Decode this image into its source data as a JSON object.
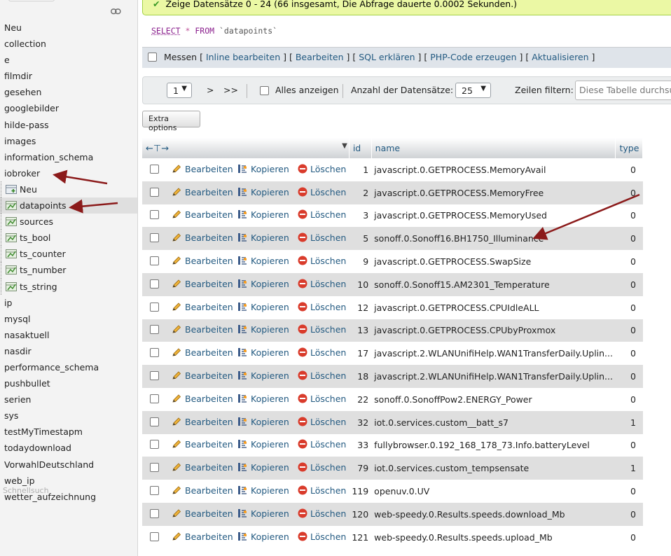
{
  "sidebar": {
    "databases": [
      {
        "label": "Neu",
        "type": "new"
      },
      {
        "label": "collection"
      },
      {
        "label": "e"
      },
      {
        "label": "filmdir"
      },
      {
        "label": "gesehen"
      },
      {
        "label": "googlebilder"
      },
      {
        "label": "hilde-pass"
      },
      {
        "label": "images"
      },
      {
        "label": "information_schema"
      },
      {
        "label": "iobroker"
      },
      {
        "label": "Neu",
        "type": "sub-new"
      },
      {
        "label": "datapoints",
        "type": "table",
        "selected": true
      },
      {
        "label": "sources",
        "type": "table"
      },
      {
        "label": "ts_bool",
        "type": "table"
      },
      {
        "label": "ts_counter",
        "type": "table"
      },
      {
        "label": "ts_number",
        "type": "table"
      },
      {
        "label": "ts_string",
        "type": "table"
      },
      {
        "label": "ip"
      },
      {
        "label": "mysql"
      },
      {
        "label": "nasaktuell"
      },
      {
        "label": "nasdir"
      },
      {
        "label": "performance_schema"
      },
      {
        "label": "pushbullet"
      },
      {
        "label": "serien"
      },
      {
        "label": "sys"
      },
      {
        "label": "testMyTimestapm"
      },
      {
        "label": "todaydownload"
      },
      {
        "label": "VorwahlDeutschland"
      },
      {
        "label": "web_ip"
      },
      {
        "label": "wetter_aufzeichnung"
      }
    ],
    "quicksearch_placeholder": "Schnellsuch"
  },
  "message": {
    "success_text": "Zeige Datensätze 0 - 24 (66 insgesamt, Die Abfrage dauerte 0.0002 Sekunden.)"
  },
  "sql": {
    "select_kw": "SELECT",
    "star": "*",
    "from_kw": "FROM",
    "table": "`datapoints`"
  },
  "actions": {
    "measure": "Messen",
    "inline_edit": "Inline bearbeiten",
    "edit": "Bearbeiten",
    "explain": "SQL erklären",
    "php": "PHP-Code erzeugen",
    "refresh": "Aktualisieren"
  },
  "navigation": {
    "page": "1",
    "next": ">",
    "last": ">>",
    "show_all": "Alles anzeigen",
    "row_count_label": "Anzahl der Datensätze:",
    "row_count": "25",
    "filter_label": "Zeilen filtern:",
    "filter_placeholder": "Diese Tabelle durchsuchen"
  },
  "extra_options": "Extra options",
  "table": {
    "headers": {
      "id": "id",
      "name": "name",
      "type": "type"
    },
    "action_labels": {
      "edit": "Bearbeiten",
      "copy": "Kopieren",
      "delete": "Löschen"
    },
    "rows": [
      {
        "id": "1",
        "name": "javascript.0.GETPROCESS.MemoryAvail",
        "type": "0"
      },
      {
        "id": "2",
        "name": "javascript.0.GETPROCESS.MemoryFree",
        "type": "0"
      },
      {
        "id": "3",
        "name": "javascript.0.GETPROCESS.MemoryUsed",
        "type": "0"
      },
      {
        "id": "5",
        "name": "sonoff.0.Sonoff16.BH1750_Illuminance",
        "type": "0"
      },
      {
        "id": "9",
        "name": "javascript.0.GETPROCESS.SwapSize",
        "type": "0"
      },
      {
        "id": "10",
        "name": "sonoff.0.Sonoff15.AM2301_Temperature",
        "type": "0"
      },
      {
        "id": "12",
        "name": "javascript.0.GETPROCESS.CPUIdleALL",
        "type": "0"
      },
      {
        "id": "13",
        "name": "javascript.0.GETPROCESS.CPUbyProxmox",
        "type": "0"
      },
      {
        "id": "17",
        "name": "javascript.2.WLANUnifiHelp.WAN1TransferDaily.Uplin...",
        "type": "0"
      },
      {
        "id": "18",
        "name": "javascript.2.WLANUnifiHelp.WAN1TransferDaily.Uplin...",
        "type": "0"
      },
      {
        "id": "22",
        "name": "sonoff.0.SonoffPow2.ENERGY_Power",
        "type": "0"
      },
      {
        "id": "32",
        "name": "iot.0.services.custom__batt_s7",
        "type": "1"
      },
      {
        "id": "33",
        "name": "fullybrowser.0.192_168_178_73.Info.batteryLevel",
        "type": "0"
      },
      {
        "id": "79",
        "name": "iot.0.services.custom_tempsensate",
        "type": "1"
      },
      {
        "id": "119",
        "name": "openuv.0.UV",
        "type": "0"
      },
      {
        "id": "120",
        "name": "web-speedy.0.Results.speeds.download_Mb",
        "type": "0"
      },
      {
        "id": "121",
        "name": "web-speedy.0.Results.speeds.upload_Mb",
        "type": "0"
      }
    ]
  },
  "colors": {
    "link": "#235a81",
    "annotation_arrow": "#8b1a1a",
    "success_bg": "#ebf8a4"
  }
}
